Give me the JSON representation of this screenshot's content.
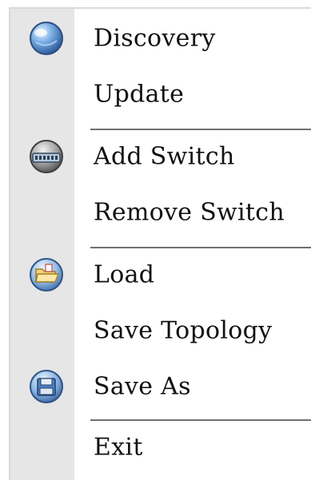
{
  "menu": {
    "items": [
      {
        "label": "Discovery",
        "icon": "globe-icon"
      },
      {
        "label": "Update"
      },
      {
        "label": "Add Switch",
        "icon": "network-switch-icon"
      },
      {
        "label": "Remove Switch"
      },
      {
        "label": "Load",
        "icon": "folder-open-icon"
      },
      {
        "label": "Save Topology"
      },
      {
        "label": "Save As",
        "icon": "floppy-disk-icon"
      },
      {
        "label": "Exit"
      }
    ]
  }
}
